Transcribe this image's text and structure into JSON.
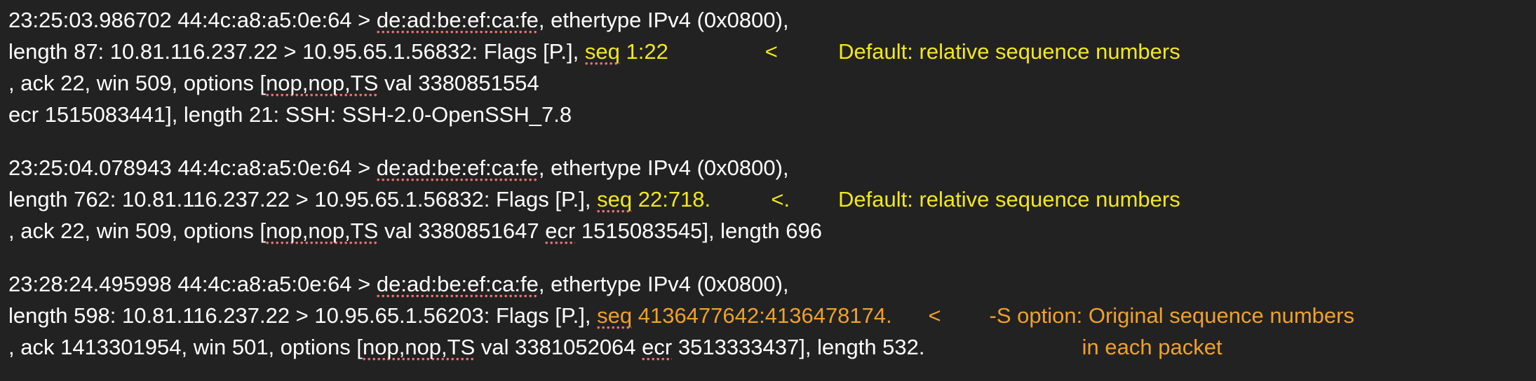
{
  "terminal": {
    "background_color": "#222222",
    "foreground_color": "#ffffff",
    "highlight_yellow": "#f2e81a",
    "highlight_orange": "#f0a128",
    "spellcheck_underline_color": "#e8706e"
  },
  "packets": [
    {
      "id": "packet-1",
      "annotation_color": "#f2e81a",
      "lines": [
        {
          "id": "p1-l1",
          "segments": [
            {
              "text": "23:25:03.986702 44:4c:a8:a5:0e:64 > ",
              "style": "plain"
            },
            {
              "text": "de:ad:be:ef:ca:fe",
              "style": "spellcheck"
            },
            {
              "text": ", ethertype IPv4 (0x0800),",
              "style": "plain"
            }
          ]
        },
        {
          "id": "p1-l2",
          "segments": [
            {
              "text": "length 87: 10.81.116.237.22 > 10.95.65.1.56832: Flags [P.], ",
              "style": "plain"
            },
            {
              "text": "seq",
              "style": "highlight-spellcheck"
            },
            {
              "text": " 1:22",
              "style": "highlight"
            },
            {
              "text": "        ",
              "style": "plain"
            },
            {
              "text": "<",
              "style": "highlight"
            },
            {
              "text": "     ",
              "style": "plain"
            },
            {
              "text": "Default: relative sequence numbers",
              "style": "highlight"
            }
          ]
        },
        {
          "id": "p1-l3",
          "segments": [
            {
              "text": ", ack 22, win 509, options [",
              "style": "plain"
            },
            {
              "text": "nop,nop,TS",
              "style": "spellcheck"
            },
            {
              "text": " val 3380851554",
              "style": "plain"
            }
          ]
        },
        {
          "id": "p1-l4",
          "segments": [
            {
              "text": "ecr 1515083441], length 21: SSH: SSH-2.0-OpenSSH_7.8",
              "style": "plain"
            }
          ]
        }
      ]
    },
    {
      "id": "packet-2",
      "annotation_color": "#f2e81a",
      "lines": [
        {
          "id": "p2-l1",
          "segments": [
            {
              "text": "23:25:04.078943 44:4c:a8:a5:0e:64 > ",
              "style": "plain"
            },
            {
              "text": "de:ad:be:ef:ca:fe",
              "style": "spellcheck"
            },
            {
              "text": ", ethertype IPv4 (0x0800),",
              "style": "plain"
            }
          ]
        },
        {
          "id": "p2-l2",
          "segments": [
            {
              "text": "length 762: 10.81.116.237.22 > 10.95.65.1.56832: Flags [P.], ",
              "style": "plain"
            },
            {
              "text": "seq",
              "style": "highlight-spellcheck"
            },
            {
              "text": " 22:718.",
              "style": "highlight"
            },
            {
              "text": "     ",
              "style": "plain"
            },
            {
              "text": "<.",
              "style": "highlight"
            },
            {
              "text": "   ",
              "style": "plain"
            },
            {
              "text": "Default: relative sequence numbers",
              "style": "highlight"
            }
          ]
        },
        {
          "id": "p2-l3",
          "segments": [
            {
              "text": ", ack 22, win 509, options [",
              "style": "plain"
            },
            {
              "text": "nop,nop,TS",
              "style": "spellcheck"
            },
            {
              "text": " val 3380851647 ",
              "style": "plain"
            },
            {
              "text": "ecr",
              "style": "spellcheck"
            },
            {
              "text": " 1515083545], length 696",
              "style": "plain"
            }
          ]
        }
      ]
    },
    {
      "id": "packet-3",
      "annotation_color": "#f0a128",
      "lines": [
        {
          "id": "p3-l1",
          "segments": [
            {
              "text": "23:28:24.495998 44:4c:a8:a5:0e:64 > ",
              "style": "plain"
            },
            {
              "text": "de:ad:be:ef:ca:fe",
              "style": "spellcheck"
            },
            {
              "text": ", ethertype IPv4 (0x0800),",
              "style": "plain"
            }
          ]
        },
        {
          "id": "p3-l2",
          "segments": [
            {
              "text": "length 598: 10.81.116.237.22 > 10.95.65.1.56203: Flags [P.], ",
              "style": "plain"
            },
            {
              "text": "seq",
              "style": "orange-spellcheck"
            },
            {
              "text": " 4136477642:4136478174.",
              "style": "orange"
            },
            {
              "text": "  ",
              "style": "plain"
            },
            {
              "text": "<",
              "style": "orange"
            },
            {
              "text": "   ",
              "style": "plain"
            },
            {
              "text": "-S option: Original sequence numbers",
              "style": "orange"
            }
          ]
        },
        {
          "id": "p3-l3",
          "segments": [
            {
              "text": ", ack 1413301954, win 501, options [",
              "style": "plain"
            },
            {
              "text": "nop,nop,TS",
              "style": "spellcheck"
            },
            {
              "text": " val 3381052064 ",
              "style": "plain"
            },
            {
              "text": "ecr",
              "style": "spellcheck"
            },
            {
              "text": " 3513333437], length 532.",
              "style": "plain"
            },
            {
              "text": "             ",
              "style": "plain"
            },
            {
              "text": "in each packet",
              "style": "orange"
            }
          ]
        }
      ]
    }
  ]
}
